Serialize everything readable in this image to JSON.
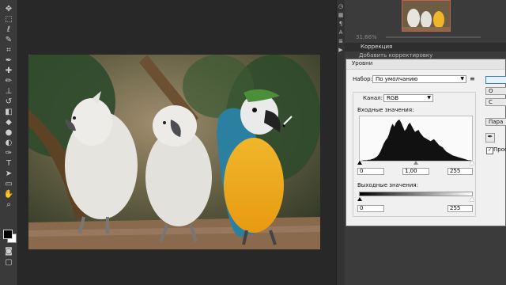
{
  "app": {
    "colors": {
      "workspace": "#282828",
      "panel": "#3b3b3b",
      "dialog": "#f0f0f0",
      "accent": "#c7604a"
    }
  },
  "toolbar": {
    "tools": [
      {
        "name": "move-icon",
        "glyph": "✥"
      },
      {
        "name": "marquee-icon",
        "glyph": "⬚"
      },
      {
        "name": "lasso-icon",
        "glyph": "ℓ"
      },
      {
        "name": "quick-select-icon",
        "glyph": "✎"
      },
      {
        "name": "crop-icon",
        "glyph": "⌗"
      },
      {
        "name": "eyedropper-icon",
        "glyph": "✒"
      },
      {
        "name": "healing-icon",
        "glyph": "✚"
      },
      {
        "name": "brush-icon",
        "glyph": "✏"
      },
      {
        "name": "stamp-icon",
        "glyph": "⊥"
      },
      {
        "name": "history-brush-icon",
        "glyph": "↺"
      },
      {
        "name": "eraser-icon",
        "glyph": "◧"
      },
      {
        "name": "paint-bucket-icon",
        "glyph": "◆"
      },
      {
        "name": "blur-icon",
        "glyph": "●"
      },
      {
        "name": "dodge-icon",
        "glyph": "◐"
      },
      {
        "name": "pen-icon",
        "glyph": "✑"
      },
      {
        "name": "type-icon",
        "glyph": "T"
      },
      {
        "name": "path-select-icon",
        "glyph": "➤"
      },
      {
        "name": "shape-icon",
        "glyph": "▭"
      },
      {
        "name": "hand-icon",
        "glyph": "✋"
      },
      {
        "name": "zoom-icon",
        "glyph": "⌕"
      }
    ],
    "extra": [
      {
        "name": "quick-mask-icon",
        "glyph": "◙"
      },
      {
        "name": "screen-mode-icon",
        "glyph": "▢"
      }
    ]
  },
  "right_strip": {
    "icons": [
      {
        "name": "history-panel-icon",
        "glyph": "◷"
      },
      {
        "name": "color-panel-icon",
        "glyph": "▦"
      },
      {
        "name": "paragraph-icon",
        "glyph": "¶"
      },
      {
        "name": "character-icon",
        "glyph": "A"
      },
      {
        "name": "layers-panel-icon",
        "glyph": "≣"
      },
      {
        "name": "actions-icon",
        "glyph": "▶"
      }
    ]
  },
  "navigator": {
    "zoom": "31,66%"
  },
  "adjustments_panel": {
    "title": "Коррекция",
    "subtitle": "Добавить корректировку"
  },
  "levels_dialog": {
    "title": "Уровни",
    "preset_label": "Набор:",
    "preset_value": "По умолчанию",
    "preset_menu_icon": "≡",
    "channel_label": "Канал:",
    "channel_value": "RGB",
    "input_label": "Входные значения:",
    "input_black": "0",
    "input_gamma": "1,00",
    "input_white": "255",
    "output_label": "Выходные значения:",
    "output_black": "0",
    "output_white": "255",
    "side_buttons": [
      "",
      "O",
      "С",
      "Пара",
      "",
      "Прос"
    ],
    "preview_checked": true
  },
  "histogram": {
    "levels": [
      0,
      0,
      1,
      1,
      1,
      2,
      2,
      3,
      4,
      6,
      8,
      12,
      18,
      26,
      34,
      40,
      44,
      52,
      64,
      72,
      66,
      74,
      78,
      80,
      74,
      66,
      58,
      62,
      70,
      74,
      68,
      62,
      56,
      58,
      60,
      54,
      50,
      46,
      44,
      42,
      40,
      38,
      40,
      42,
      38,
      34,
      30,
      28,
      26,
      22,
      18,
      16,
      14,
      12,
      10,
      9,
      8,
      7,
      6,
      5,
      4,
      3,
      2,
      1,
      1,
      0
    ]
  }
}
